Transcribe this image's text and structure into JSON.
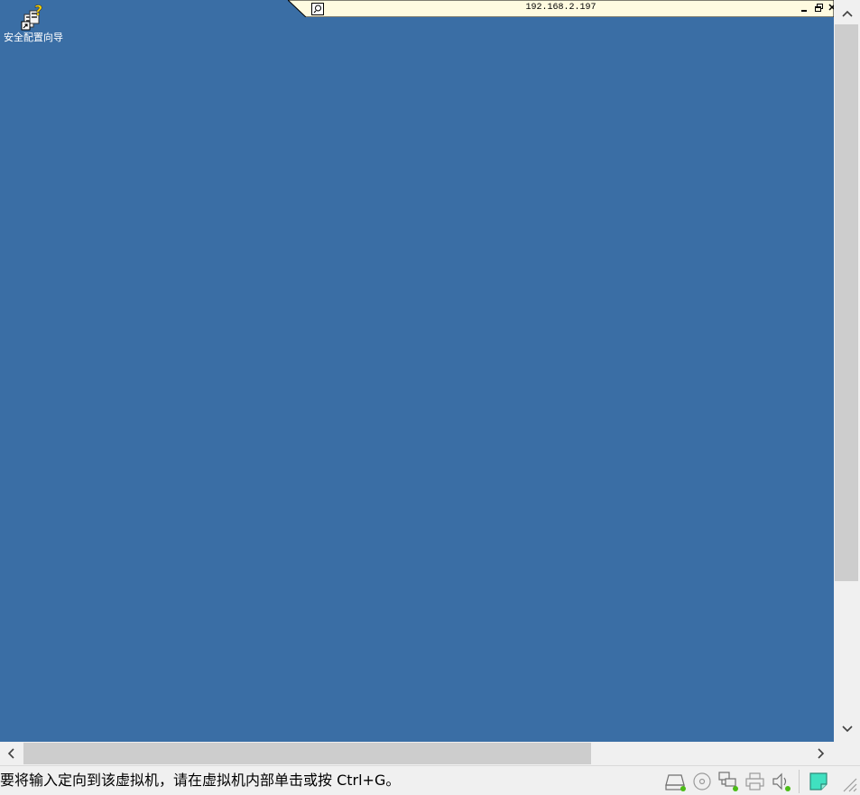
{
  "desktop": {
    "background_color": "#3a6ea5",
    "icons": [
      {
        "label": "安全配置向导",
        "icon": "security-wizard-icon"
      }
    ]
  },
  "connection_bar": {
    "host": "192.168.2.197",
    "pin_icon": "pin-icon",
    "minimize_icon": "minimize-icon",
    "restore_icon": "restore-icon",
    "close_icon": "close-icon"
  },
  "status_bar": {
    "message": "要将输入定向到该虚拟机，请在虚拟机内部单击或按 Ctrl+G。",
    "devices": [
      {
        "icon": "hard-disk-icon",
        "active": true
      },
      {
        "icon": "cd-dvd-icon",
        "active": false
      },
      {
        "icon": "network-adapter-icon",
        "active": true
      },
      {
        "icon": "printer-icon",
        "active": false
      },
      {
        "icon": "sound-card-icon",
        "active": true
      },
      {
        "icon": "message-log-icon",
        "active": false
      }
    ],
    "active_color": "#4cbb17"
  }
}
